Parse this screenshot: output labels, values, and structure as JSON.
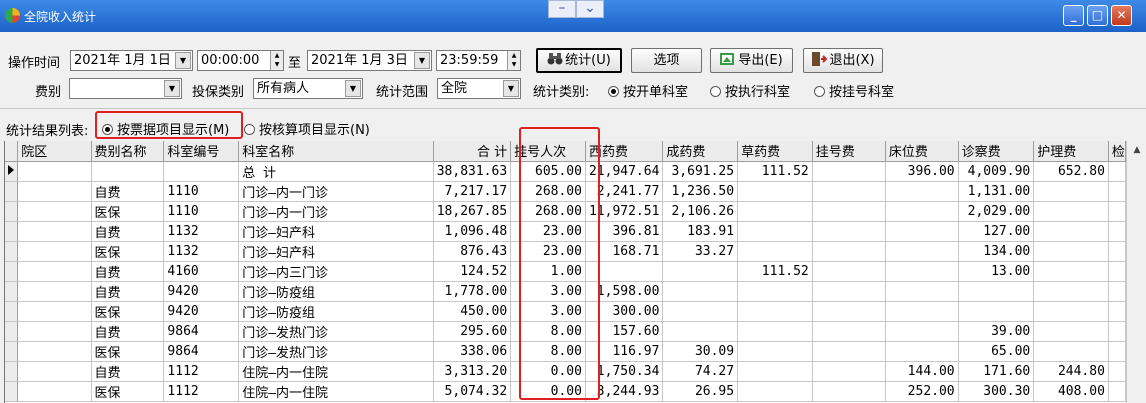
{
  "window": {
    "title": "全院收入统计"
  },
  "filters": {
    "time_label": "操作时间",
    "start_date": "2021年 1月 1日",
    "start_time": "00:00:00",
    "to_label": "至",
    "end_date": "2021年 1月 3日",
    "end_time": "23:59:59",
    "fee_type_label": "费别",
    "fee_type_value": "",
    "insurance_label": "投保类别",
    "insurance_value": "所有病人",
    "scope_label": "统计范围",
    "scope_value": "全院",
    "stat_type_label": "统计类别:",
    "stat_options": [
      "按开单科室",
      "按执行科室",
      "按挂号科室"
    ],
    "stat_selected": "按开单科室"
  },
  "buttons": {
    "stats": "统计(U)",
    "options": "选项",
    "export": "导出(E)",
    "exit": "退出(X)"
  },
  "list_mode": {
    "label": "统计结果列表:",
    "by_receipt": "按票据项目显示(M)",
    "by_accounting": "按核算项目显示(N)",
    "selected": "按票据项目显示(M)"
  },
  "table": {
    "columns": [
      "院区",
      "费别名称",
      "科室编号",
      "科室名称",
      "合 计",
      "挂号人次",
      "西药费",
      "成药费",
      "草药费",
      "挂号费",
      "床位费",
      "诊察费",
      "护理费",
      "检"
    ],
    "rows": [
      [
        "",
        "",
        "",
        "总 计",
        "38,831.63",
        "605.00",
        "21,947.64",
        "3,691.25",
        "111.52",
        "",
        "396.00",
        "4,009.90",
        "652.80"
      ],
      [
        "",
        "自费",
        "1110",
        "门诊—内一门诊",
        "7,217.17",
        "268.00",
        "2,241.77",
        "1,236.50",
        "",
        "",
        "",
        "1,131.00",
        ""
      ],
      [
        "",
        "医保",
        "1110",
        "门诊—内一门诊",
        "18,267.85",
        "268.00",
        "11,972.51",
        "2,106.26",
        "",
        "",
        "",
        "2,029.00",
        ""
      ],
      [
        "",
        "自费",
        "1132",
        "门诊—妇产科",
        "1,096.48",
        "23.00",
        "396.81",
        "183.91",
        "",
        "",
        "",
        "127.00",
        ""
      ],
      [
        "",
        "医保",
        "1132",
        "门诊—妇产科",
        "876.43",
        "23.00",
        "168.71",
        "33.27",
        "",
        "",
        "",
        "134.00",
        ""
      ],
      [
        "",
        "自费",
        "4160",
        "门诊—内三门诊",
        "124.52",
        "1.00",
        "",
        "",
        "111.52",
        "",
        "",
        "13.00",
        ""
      ],
      [
        "",
        "自费",
        "9420",
        "门诊—防疫组",
        "1,778.00",
        "3.00",
        "1,598.00",
        "",
        "",
        "",
        "",
        "",
        ""
      ],
      [
        "",
        "医保",
        "9420",
        "门诊—防疫组",
        "450.00",
        "3.00",
        "300.00",
        "",
        "",
        "",
        "",
        "",
        ""
      ],
      [
        "",
        "自费",
        "9864",
        "门诊—发热门诊",
        "295.60",
        "8.00",
        "157.60",
        "",
        "",
        "",
        "",
        "39.00",
        ""
      ],
      [
        "",
        "医保",
        "9864",
        "门诊—发热门诊",
        "338.06",
        "8.00",
        "116.97",
        "30.09",
        "",
        "",
        "",
        "65.00",
        ""
      ],
      [
        "",
        "自费",
        "1112",
        "住院—内一住院",
        "3,313.20",
        "0.00",
        "1,750.34",
        "74.27",
        "",
        "",
        "144.00",
        "171.60",
        "244.80"
      ],
      [
        "",
        "医保",
        "1112",
        "住院—内一住院",
        "5,074.32",
        "0.00",
        "3,244.93",
        "26.95",
        "",
        "",
        "252.00",
        "300.30",
        "408.00"
      ]
    ]
  },
  "colors": {
    "title_bar": "#1c62c8",
    "highlight": "#e02020"
  }
}
